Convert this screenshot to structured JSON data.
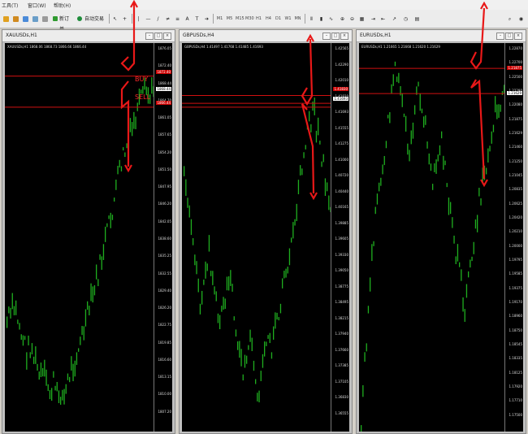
{
  "menu": [
    "工具(T)",
    "窗口(W)",
    "帮助(H)"
  ],
  "toolbar": {
    "new_order": "新订单",
    "autotrade": "自动交易",
    "timeframes": [
      "M1",
      "M5",
      "M15",
      "M30",
      "H1",
      "H4",
      "D1",
      "W1",
      "MN"
    ]
  },
  "windows": [
    {
      "title": "XAUUSDs,H1",
      "ohlc": "XAUUSDs,H1  1868.06 1868.73 1866.66 1866.44",
      "ticks": [
        "1876.05",
        "1872.40",
        "1868.44",
        "1864.70",
        "1861.05",
        "1857.65",
        "1854.20",
        "1851.50",
        "1847.95",
        "1846.20",
        "1842.05",
        "1838.60",
        "1835.25",
        "1832.55",
        "1829.40",
        "1826.20",
        "1822.75",
        "1819.85",
        "1816.60",
        "1813.15",
        "1810.00",
        "1807.20"
      ],
      "markers": [
        {
          "label": "1872.40",
          "style": "red"
        },
        {
          "label": "1868.44",
          "style": "white"
        },
        {
          "label": "1866.44",
          "style": "red"
        }
      ],
      "annotations": [
        "BUY",
        "SELL"
      ]
    },
    {
      "title": "GBPUSDs,H4",
      "ohlc": "GBPUSDs,H4  1.41497 1.41768 1.41485 1.41693",
      "ticks": [
        "1.42565",
        "1.42290",
        "1.42010",
        "1.41830",
        "1.41693",
        "1.41555",
        "1.41275",
        "1.41000",
        "1.40720",
        "1.40440",
        "1.40165",
        "1.39885",
        "1.39605",
        "1.39330",
        "1.39050",
        "1.38775",
        "1.38495",
        "1.38215",
        "1.37940",
        "1.37660",
        "1.37385",
        "1.37105",
        "1.36830",
        "1.36555"
      ],
      "markers": [
        {
          "label": "1.41830",
          "style": "red"
        },
        {
          "label": "1.41693",
          "style": "white"
        }
      ],
      "annotations": []
    },
    {
      "title": "EURUSDs,H1",
      "ohlc": "EURUSDs,H1  1.21665 1.21668 1.21620 1.21629",
      "ticks": [
        "1.22870",
        "1.22700",
        "1.22500",
        "1.22290",
        "1.22080",
        "1.21875",
        "1.21629",
        "1.21460",
        "1.21250",
        "1.21045",
        "1.20835",
        "1.20625",
        "1.20420",
        "1.20210",
        "1.20000",
        "1.19795",
        "1.19585",
        "1.19375",
        "1.19170",
        "1.18960",
        "1.18750",
        "1.18545",
        "1.18335",
        "1.18125",
        "1.17920",
        "1.17710",
        "1.17500"
      ],
      "markers": [
        {
          "label": "1.21875",
          "style": "red"
        },
        {
          "label": "1.21629",
          "style": "white"
        }
      ],
      "annotations": []
    }
  ],
  "colors": {
    "candle": "#1fae1f",
    "level": "#d01010",
    "arrow": "#e81818"
  }
}
